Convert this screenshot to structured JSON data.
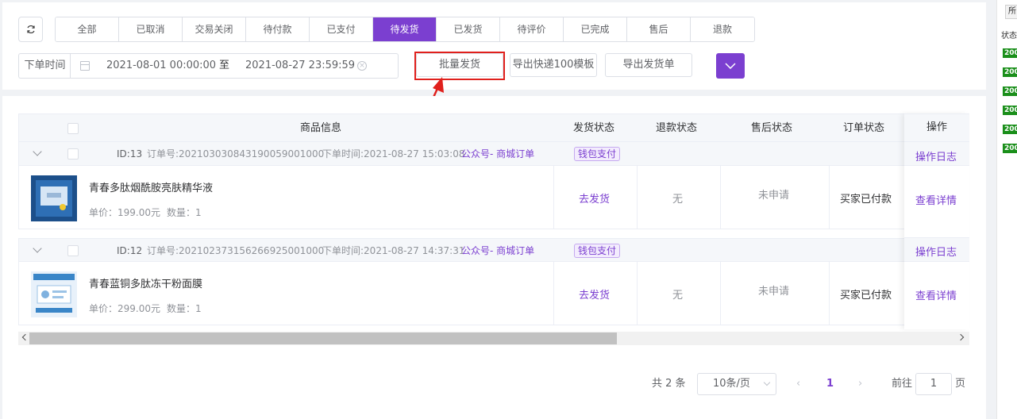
{
  "toolbar": {
    "tabs": [
      "全部",
      "已取消",
      "交易关闭",
      "待付款",
      "已支付",
      "待发货",
      "已发货",
      "待评价",
      "已完成",
      "售后",
      "退款"
    ],
    "active_tab": "待发货"
  },
  "filter": {
    "date_label": "下单时间",
    "start_date": "2021-08-01 00:00:00",
    "range_separator": "至",
    "end_date": "2021-08-27 23:59:59",
    "batch_ship": "批量发货",
    "export_kuaidi100": "导出快递100模板",
    "export_ship": "导出发货单"
  },
  "table": {
    "headers": {
      "product": "商品信息",
      "ship_status": "发货状态",
      "refund_status": "退款状态",
      "aftersale_status": "售后状态",
      "order_status": "订单状态",
      "ops": "操作"
    },
    "orders": [
      {
        "id": "ID:13",
        "order_no": "订单号:202103030843190059001000",
        "order_time": "下单时间:2021-08-27 15:03:08",
        "source": "公众号- 商城订单",
        "pay_type": "钱包支付",
        "op_log": "操作日志",
        "product_name": "青春多肽烟酰胺亮肤精华液",
        "price": "单价：199.00元",
        "qty": "数量：1",
        "ship": "去发货",
        "refund": "无",
        "aftersale": "未申请",
        "state": "买家已付款",
        "detail": "查看详情"
      },
      {
        "id": "ID:12",
        "order_no": "订单号:202102373156266925001000",
        "order_time": "下单时间:2021-08-27 14:37:31",
        "source": "公众号- 商城订单",
        "pay_type": "钱包支付",
        "op_log": "操作日志",
        "product_name": "青春蓝铜多肽冻干粉面膜",
        "price": "单价：299.00元",
        "qty": "数量：1",
        "ship": "去发货",
        "refund": "无",
        "aftersale": "未申请",
        "state": "买家已付款",
        "detail": "查看详情"
      }
    ]
  },
  "pagination": {
    "total": "共 2 条",
    "page_size": "10条/页",
    "current_page": "1",
    "goto_label": "前往",
    "goto_value": "1",
    "page_unit": "页"
  },
  "side_panel": {
    "header": "所",
    "label": "状态",
    "codes": [
      "200",
      "200",
      "200",
      "200",
      "200",
      "200"
    ]
  }
}
